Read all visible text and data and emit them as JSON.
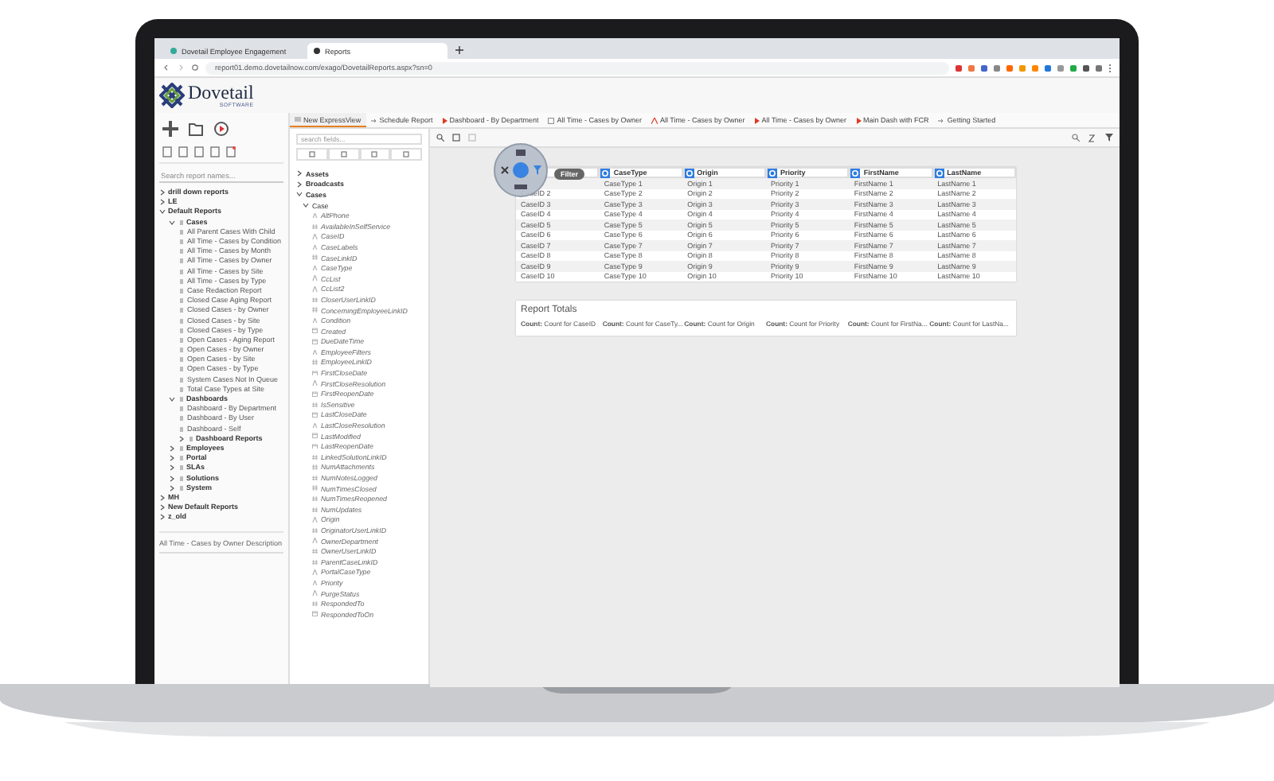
{
  "browser": {
    "tabs": [
      {
        "label": "Dovetail Employee Engagement",
        "selected": false
      },
      {
        "label": "Reports",
        "selected": true
      }
    ],
    "address": "report01.demo.dovetailnow.com/exago/DovetailReports.aspx?sn=0"
  },
  "logo": {
    "name": "Dovetail",
    "tagline": "SOFTWARE"
  },
  "report_search": {
    "placeholder": "Search report names..."
  },
  "tree": [
    {
      "label": "drill down reports",
      "kind": "folder",
      "expanded": false
    },
    {
      "label": "LE",
      "kind": "folder",
      "expanded": false
    },
    {
      "label": "Default Reports",
      "kind": "folder",
      "expanded": true,
      "children": [
        {
          "label": "Cases",
          "kind": "folder",
          "expanded": true,
          "children": [
            {
              "label": "All Parent Cases With Child",
              "kind": "report"
            },
            {
              "label": "All Time - Cases by Condition",
              "kind": "report"
            },
            {
              "label": "All Time - Cases by Month",
              "kind": "report"
            },
            {
              "label": "All Time - Cases by Owner",
              "kind": "report"
            },
            {
              "label": "All Time - Cases by Site",
              "kind": "report"
            },
            {
              "label": "All Time - Cases by Type",
              "kind": "report"
            },
            {
              "label": "Case Redaction Report",
              "kind": "report"
            },
            {
              "label": "Closed Case Aging Report",
              "kind": "report"
            },
            {
              "label": "Closed Cases - by Owner",
              "kind": "report"
            },
            {
              "label": "Closed Cases - by Site",
              "kind": "report"
            },
            {
              "label": "Closed Cases - by Type",
              "kind": "report"
            },
            {
              "label": "Open Cases - Aging Report",
              "kind": "report"
            },
            {
              "label": "Open Cases - by Owner",
              "kind": "report"
            },
            {
              "label": "Open Cases - by Site",
              "kind": "report"
            },
            {
              "label": "Open Cases - by Type",
              "kind": "report"
            },
            {
              "label": "System Cases Not In Queue",
              "kind": "report"
            },
            {
              "label": "Total Case Types at Site",
              "kind": "report"
            }
          ]
        },
        {
          "label": "Dashboards",
          "kind": "folder",
          "expanded": true,
          "children": [
            {
              "label": "Dashboard - By Department",
              "kind": "report"
            },
            {
              "label": "Dashboard - By User",
              "kind": "report"
            },
            {
              "label": "Dashboard - Self",
              "kind": "report"
            },
            {
              "label": "Dashboard Reports",
              "kind": "folder",
              "expanded": false
            }
          ]
        },
        {
          "label": "Employees",
          "kind": "folder",
          "expanded": false
        },
        {
          "label": "Portal",
          "kind": "folder",
          "expanded": false
        },
        {
          "label": "SLAs",
          "kind": "folder",
          "expanded": false
        },
        {
          "label": "Solutions",
          "kind": "folder",
          "expanded": false
        },
        {
          "label": "System",
          "kind": "folder",
          "expanded": false
        }
      ]
    },
    {
      "label": "MH",
      "kind": "folder",
      "expanded": false
    },
    {
      "label": "New Default Reports",
      "kind": "folder",
      "expanded": false
    },
    {
      "label": "z_old",
      "kind": "folder",
      "expanded": false
    }
  ],
  "description": "All Time - Cases by Owner Description",
  "tabs": [
    {
      "label": "New ExpressView",
      "kind": "expressview",
      "selected": true
    },
    {
      "label": "Schedule Report",
      "kind": "schedule",
      "selected": false
    },
    {
      "label": "Dashboard - By Department",
      "kind": "dashboard",
      "selected": false
    },
    {
      "label": "All Time - Cases by Owner",
      "kind": "grid",
      "selected": false
    },
    {
      "label": "All Time - Cases by Owner",
      "kind": "chart",
      "selected": false
    },
    {
      "label": "All Time - Cases by Owner",
      "kind": "dashboard",
      "selected": false
    },
    {
      "label": "Main Dash with FCR",
      "kind": "dashboard",
      "selected": false
    },
    {
      "label": "Getting Started",
      "kind": "schedule",
      "selected": false
    }
  ],
  "field_search": {
    "placeholder": "search fields..."
  },
  "field_groups": [
    {
      "label": "Assets",
      "expanded": false
    },
    {
      "label": "Broadcasts",
      "expanded": false
    },
    {
      "label": "Cases",
      "expanded": true
    }
  ],
  "entity": {
    "label": "Case",
    "expanded": true
  },
  "fields": [
    {
      "label": "AltPhone",
      "kind": "text"
    },
    {
      "label": "AvailableInSelfService",
      "kind": "number"
    },
    {
      "label": "CaseID",
      "kind": "text"
    },
    {
      "label": "CaseLabels",
      "kind": "text"
    },
    {
      "label": "CaseLinkID",
      "kind": "number"
    },
    {
      "label": "CaseType",
      "kind": "text"
    },
    {
      "label": "CcList",
      "kind": "text"
    },
    {
      "label": "CcList2",
      "kind": "text"
    },
    {
      "label": "CloserUserLinkID",
      "kind": "number"
    },
    {
      "label": "ConcerningEmployeeLinkID",
      "kind": "number"
    },
    {
      "label": "Condition",
      "kind": "text"
    },
    {
      "label": "Created",
      "kind": "date"
    },
    {
      "label": "DueDateTime",
      "kind": "date"
    },
    {
      "label": "EmployeeFilters",
      "kind": "text"
    },
    {
      "label": "EmployeeLinkID",
      "kind": "number"
    },
    {
      "label": "FirstCloseDate",
      "kind": "date"
    },
    {
      "label": "FirstCloseResolution",
      "kind": "text"
    },
    {
      "label": "FirstReopenDate",
      "kind": "date"
    },
    {
      "label": "IsSensitive",
      "kind": "number"
    },
    {
      "label": "LastCloseDate",
      "kind": "date"
    },
    {
      "label": "LastCloseResolution",
      "kind": "text"
    },
    {
      "label": "LastModified",
      "kind": "date"
    },
    {
      "label": "LastReopenDate",
      "kind": "date"
    },
    {
      "label": "LinkedSolutionLinkID",
      "kind": "number"
    },
    {
      "label": "NumAttachments",
      "kind": "number"
    },
    {
      "label": "NumNotesLogged",
      "kind": "number"
    },
    {
      "label": "NumTimesClosed",
      "kind": "number"
    },
    {
      "label": "NumTimesReopened",
      "kind": "number"
    },
    {
      "label": "NumUpdates",
      "kind": "number"
    },
    {
      "label": "Origin",
      "kind": "text"
    },
    {
      "label": "OriginatorUserLinkID",
      "kind": "number"
    },
    {
      "label": "OwnerDepartment",
      "kind": "text"
    },
    {
      "label": "OwnerUserLinkID",
      "kind": "number"
    },
    {
      "label": "ParentCaseLinkID",
      "kind": "number"
    },
    {
      "label": "PortalCaseType",
      "kind": "text"
    },
    {
      "label": "Priority",
      "kind": "text"
    },
    {
      "label": "PurgeStatus",
      "kind": "text"
    },
    {
      "label": "RespondedTo",
      "kind": "number"
    },
    {
      "label": "RespondedToOn",
      "kind": "date"
    }
  ],
  "filter_label": "Filter",
  "table": {
    "columns": [
      "CaseType",
      "Origin",
      "Priority",
      "FirstName",
      "LastName"
    ],
    "rows": [
      {
        "case_id": null,
        "cells": [
          "CaseType 1",
          "Origin 1",
          "Priority 1",
          "FirstName 1",
          "LastName 1"
        ]
      },
      {
        "case_id": "CaseID 2",
        "cells": [
          "CaseType 2",
          "Origin 2",
          "Priority 2",
          "FirstName 2",
          "LastName 2"
        ]
      },
      {
        "case_id": "CaseID 3",
        "cells": [
          "CaseType 3",
          "Origin 3",
          "Priority 3",
          "FirstName 3",
          "LastName 3"
        ]
      },
      {
        "case_id": "CaseID 4",
        "cells": [
          "CaseType 4",
          "Origin 4",
          "Priority 4",
          "FirstName 4",
          "LastName 4"
        ]
      },
      {
        "case_id": "CaseID 5",
        "cells": [
          "CaseType 5",
          "Origin 5",
          "Priority 5",
          "FirstName 5",
          "LastName 5"
        ]
      },
      {
        "case_id": "CaseID 6",
        "cells": [
          "CaseType 6",
          "Origin 6",
          "Priority 6",
          "FirstName 6",
          "LastName 6"
        ]
      },
      {
        "case_id": "CaseID 7",
        "cells": [
          "CaseType 7",
          "Origin 7",
          "Priority 7",
          "FirstName 7",
          "LastName 7"
        ]
      },
      {
        "case_id": "CaseID 8",
        "cells": [
          "CaseType 8",
          "Origin 8",
          "Priority 8",
          "FirstName 8",
          "LastName 8"
        ]
      },
      {
        "case_id": "CaseID 9",
        "cells": [
          "CaseType 9",
          "Origin 9",
          "Priority 9",
          "FirstName 9",
          "LastName 9"
        ]
      },
      {
        "case_id": "CaseID 10",
        "cells": [
          "CaseType 10",
          "Origin 10",
          "Priority 10",
          "FirstName 10",
          "LastName 10"
        ]
      }
    ]
  },
  "totals": {
    "title": "Report Totals",
    "items": [
      "**Count:** Count for CaseID",
      "**Count:** Count for CaseTy...",
      "**Count:** Count for Origin",
      "**Count:** Count for Priority",
      "**Count:** Count for FirstNa...",
      "**Count:** Count for LastNa..."
    ]
  }
}
